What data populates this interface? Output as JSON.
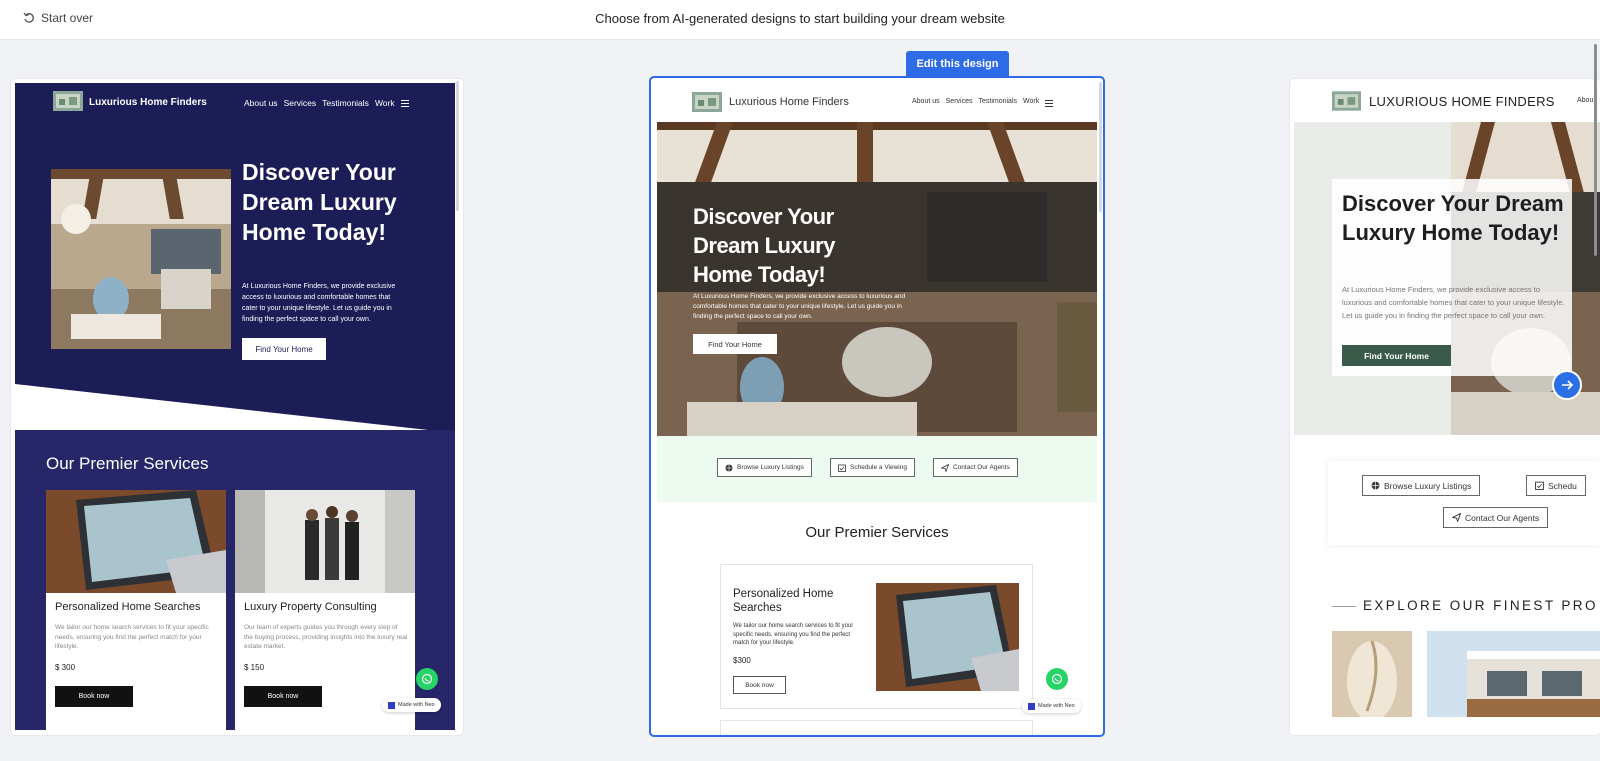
{
  "topbar": {
    "start_over": "Start over",
    "title": "Choose from AI-generated designs to start building your dream website"
  },
  "edit_button": "Edit this design",
  "brand_name": "Luxurious Home Finders",
  "brand_name_upper": "LUXURIOUS HOME FINDERS",
  "nav": [
    "About us",
    "Services",
    "Testimonials",
    "Work"
  ],
  "nav_cut": "Abou",
  "hero": {
    "title": "Discover Your Dream Luxury Home Today!",
    "text": "At Luxurious Home Finders, we provide exclusive access to luxurious and comfortable homes that cater to your unique lifestyle. Let us guide you in finding the perfect space to call your own.",
    "cta": "Find Your Home"
  },
  "actions": [
    "Browse Luxury Listings",
    "Schedule a Viewing",
    "Contact Our Agents"
  ],
  "action_cut": "Schedu",
  "services": {
    "heading": "Our Premier Services",
    "items": [
      {
        "title": "Personalized Home Searches",
        "text": "We tailor our home search services to fit your specific needs, ensuring you find the perfect match for your lifestyle.",
        "price": "$ 300",
        "price_alt": "$300",
        "cta": "Book now"
      },
      {
        "title": "Luxury Property Consulting",
        "text": "Our team of experts guides you through every step of the buying process, providing insights into the luxury real estate market.",
        "price": "$ 150",
        "cta": "Book now"
      }
    ]
  },
  "explore_heading": "EXPLORE OUR FINEST PRO",
  "made_with": "Made with Neo",
  "colors": {
    "accent": "#2e6be6",
    "navy": "#1c1d57",
    "green_button": "#3a5a4a",
    "whatsapp": "#25d366"
  }
}
